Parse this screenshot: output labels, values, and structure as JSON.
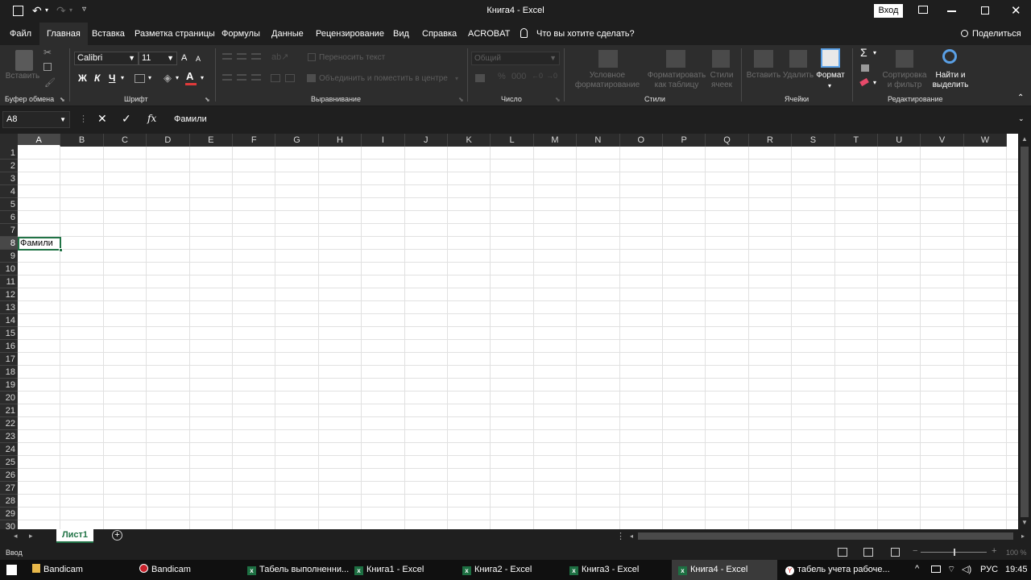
{
  "window": {
    "title": "Книга4  -  Excel",
    "signin_label": "Вход"
  },
  "menu": {
    "file": "Файл",
    "tabs": [
      "Главная",
      "Вставка",
      "Разметка страницы",
      "Формулы",
      "Данные",
      "Рецензирование",
      "Вид",
      "Справка",
      "ACROBAT"
    ],
    "tellme": "Что вы хотите сделать?",
    "share": "Поделиться"
  },
  "ribbon": {
    "clipboard": {
      "label": "Буфер обмена",
      "paste": "Вставить"
    },
    "font": {
      "label": "Шрифт",
      "name": "Calibri",
      "size": "11",
      "bold": "Ж",
      "italic": "К",
      "underline": "Ч",
      "grow": "A",
      "shrink": "A"
    },
    "alignment": {
      "label": "Выравнивание",
      "wrap": "Переносить текст",
      "merge": "Объединить и поместить в центре"
    },
    "number": {
      "label": "Число",
      "format": "Общий"
    },
    "styles": {
      "label": "Стили",
      "conditional": "Условное форматирование",
      "as_table": "Форматировать как таблицу",
      "cell_styles": "Стили ячеек"
    },
    "cells": {
      "label": "Ячейки",
      "insert": "Вставить",
      "delete": "Удалить",
      "format": "Формат"
    },
    "editing": {
      "label": "Редактирование",
      "sort": "Сортировка и фильтр",
      "find": "Найти и выделить",
      "sigma": "Σ"
    }
  },
  "formula_bar": {
    "name_box": "A8",
    "fx": "fx",
    "value": "Фамили"
  },
  "grid": {
    "columns": [
      "A",
      "B",
      "C",
      "D",
      "E",
      "F",
      "G",
      "H",
      "I",
      "J",
      "K",
      "L",
      "M",
      "N",
      "O",
      "P",
      "Q",
      "R",
      "S",
      "T",
      "U",
      "V",
      "W"
    ],
    "rows": [
      "1",
      "2",
      "3",
      "4",
      "5",
      "6",
      "7",
      "8",
      "9",
      "10",
      "11",
      "12",
      "13",
      "14",
      "15",
      "16",
      "17",
      "18",
      "19",
      "20",
      "21",
      "22",
      "23",
      "24",
      "25",
      "26",
      "27",
      "28",
      "29",
      "30"
    ],
    "active_cell": {
      "ref": "A8",
      "value": "Фамили"
    }
  },
  "sheets": {
    "tabs": [
      "Лист1"
    ]
  },
  "status": {
    "mode": "Ввод",
    "zoom": "100 %"
  },
  "taskbar": {
    "items": [
      "Bandicam",
      "Bandicam",
      "Табель выполненни...",
      "Книга1 - Excel",
      "Книга2 - Excel",
      "Книга3 - Excel",
      "Книга4 - Excel",
      "табель учета рабоче..."
    ],
    "lang": "РУС",
    "time": "19:45"
  },
  "colors": {
    "accent": "#217346",
    "background": "#1f1f1f",
    "ribbon": "#2d2d2d"
  }
}
